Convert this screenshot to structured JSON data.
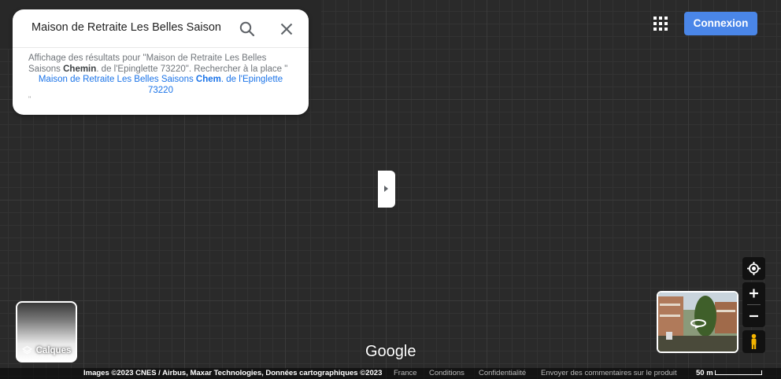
{
  "search": {
    "query": "Maison de Retraite Les Belles Saison",
    "results_prefix": "Affichage des résultats pour \"Maison de Retraite Les Belles Saisons ",
    "results_bold": "Chemin",
    "results_suffix": ". de l'Epinglette 73220\". Rechercher à la place \"",
    "alt_prefix": "Maison de Retraite Les Belles Saisons ",
    "alt_bold": "Chem",
    "alt_suffix": ". de l'Epinglette 73220",
    "alt_trailing": "\""
  },
  "header": {
    "login_label": "Connexion"
  },
  "layers": {
    "label": "Calques"
  },
  "logo": "Google",
  "footer": {
    "attribution": "Images ©2023 CNES / Airbus, Maxar Technologies, Données cartographiques ©2023",
    "links": [
      "France",
      "Conditions",
      "Confidentialité",
      "Envoyer des commentaires sur le produit"
    ],
    "scale": "50 m"
  },
  "colors": {
    "accent": "#4a86e8",
    "link": "#1a73e8",
    "map_background": "#2a2a2a"
  },
  "icons": [
    "search-icon",
    "close-icon",
    "apps-grid-icon",
    "chevron-right-icon",
    "layers-icon",
    "my-location-icon",
    "zoom-in-icon",
    "zoom-out-icon",
    "pegman-icon",
    "rotate-360-icon"
  ]
}
